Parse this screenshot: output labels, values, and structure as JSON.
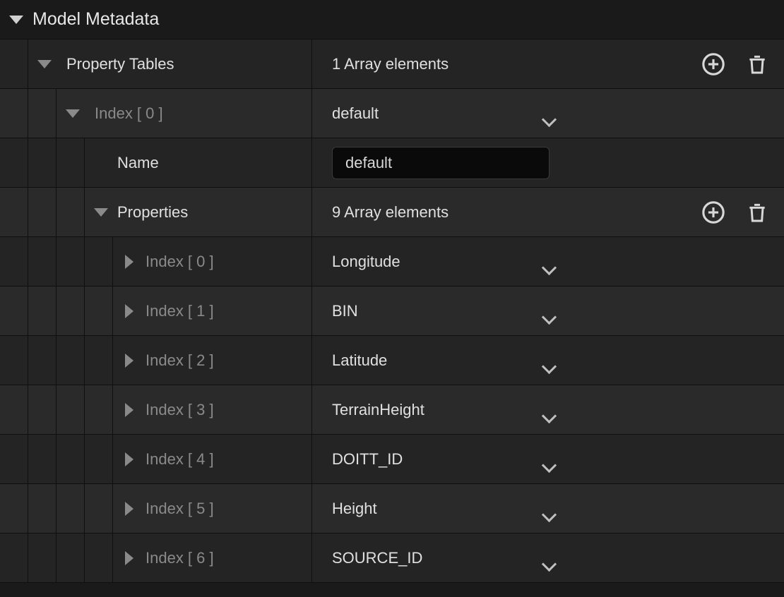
{
  "header": {
    "title": "Model Metadata"
  },
  "propertyTables": {
    "label": "Property Tables",
    "arraySummary": "1 Array elements",
    "index0": {
      "label": "Index [ 0 ]",
      "selected": "default",
      "nameField": {
        "label": "Name",
        "value": "default"
      },
      "properties": {
        "label": "Properties",
        "arraySummary": "9 Array elements",
        "items": [
          {
            "indexLabel": "Index [ 0 ]",
            "value": "Longitude"
          },
          {
            "indexLabel": "Index [ 1 ]",
            "value": "BIN"
          },
          {
            "indexLabel": "Index [ 2 ]",
            "value": "Latitude"
          },
          {
            "indexLabel": "Index [ 3 ]",
            "value": "TerrainHeight"
          },
          {
            "indexLabel": "Index [ 4 ]",
            "value": "DOITT_ID"
          },
          {
            "indexLabel": "Index [ 5 ]",
            "value": "Height"
          },
          {
            "indexLabel": "Index [ 6 ]",
            "value": "SOURCE_ID"
          }
        ]
      }
    }
  }
}
